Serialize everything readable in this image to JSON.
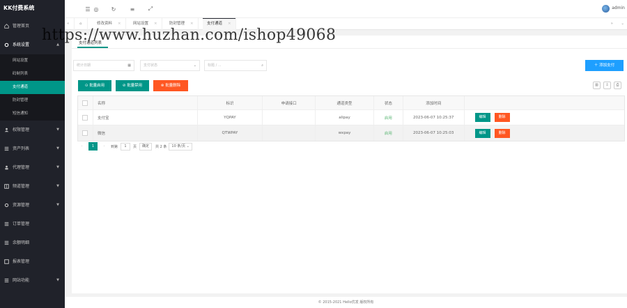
{
  "app": {
    "title": "KK付费系统"
  },
  "sidebar": {
    "items": [
      {
        "label": "管理首页",
        "icon": "home-icon"
      },
      {
        "label": "系统设置",
        "icon": "gear-icon",
        "open": true,
        "children": [
          {
            "label": "网站设置"
          },
          {
            "label": "码制列表"
          },
          {
            "label": "支付通道",
            "active": true
          },
          {
            "label": "防封管理"
          },
          {
            "label": "短信通知"
          }
        ]
      },
      {
        "label": "权限管理",
        "icon": "user-icon"
      },
      {
        "label": "资产列表",
        "icon": "list-icon"
      },
      {
        "label": "代理管理",
        "icon": "person-icon"
      },
      {
        "label": "频道管理",
        "icon": "grid-icon"
      },
      {
        "label": "资源管理",
        "icon": "gear-icon"
      },
      {
        "label": "订单管理",
        "icon": "list-icon"
      },
      {
        "label": "余额明细",
        "icon": "list-icon"
      },
      {
        "label": "报表管理",
        "icon": "grid-icon"
      },
      {
        "label": "网站功能",
        "icon": "list-icon"
      }
    ]
  },
  "topbar": {
    "admin_name": "admin"
  },
  "tabs": [
    {
      "label": "修改资料"
    },
    {
      "label": "网站设置"
    },
    {
      "label": "防封管理"
    },
    {
      "label": "支付通道",
      "active": true
    }
  ],
  "watermark": "https://www.huzhan.com/ishop49068",
  "card": {
    "tab_label": "支付通道列表"
  },
  "filters": {
    "f1_placeholder": "统计日期",
    "f2_placeholder": "支付状态",
    "f3_placeholder": "标题 / ..."
  },
  "buttons": {
    "add": "添加支付",
    "batch_enable": "批量启用",
    "batch_disable": "批量禁用",
    "batch_delete": "批量删除"
  },
  "table": {
    "headers": [
      "",
      "名称",
      "标识",
      "申请接口",
      "通道类型",
      "状态",
      "添加时间",
      ""
    ],
    "rows": [
      {
        "name": "支付宝",
        "code": "YQPAY",
        "api": "",
        "type": "alipay",
        "status": "启用",
        "time": "2023-06-07 10:25:37",
        "edit": "编辑",
        "del": "删除"
      },
      {
        "name": "微信",
        "code": "QTWPAY",
        "api": "",
        "type": "wxpay",
        "status": "启用",
        "time": "2023-06-07 10:25:03",
        "edit": "编辑",
        "del": "删除"
      }
    ]
  },
  "pager": {
    "current": "1",
    "goto_label": "到第",
    "page_value": "1",
    "page_unit": "页",
    "go_label": "确定",
    "total": "共 2 条",
    "per_page": "10 条/页"
  },
  "footer": {
    "text": "© 2015-2021 Hello优发 版权所有"
  }
}
